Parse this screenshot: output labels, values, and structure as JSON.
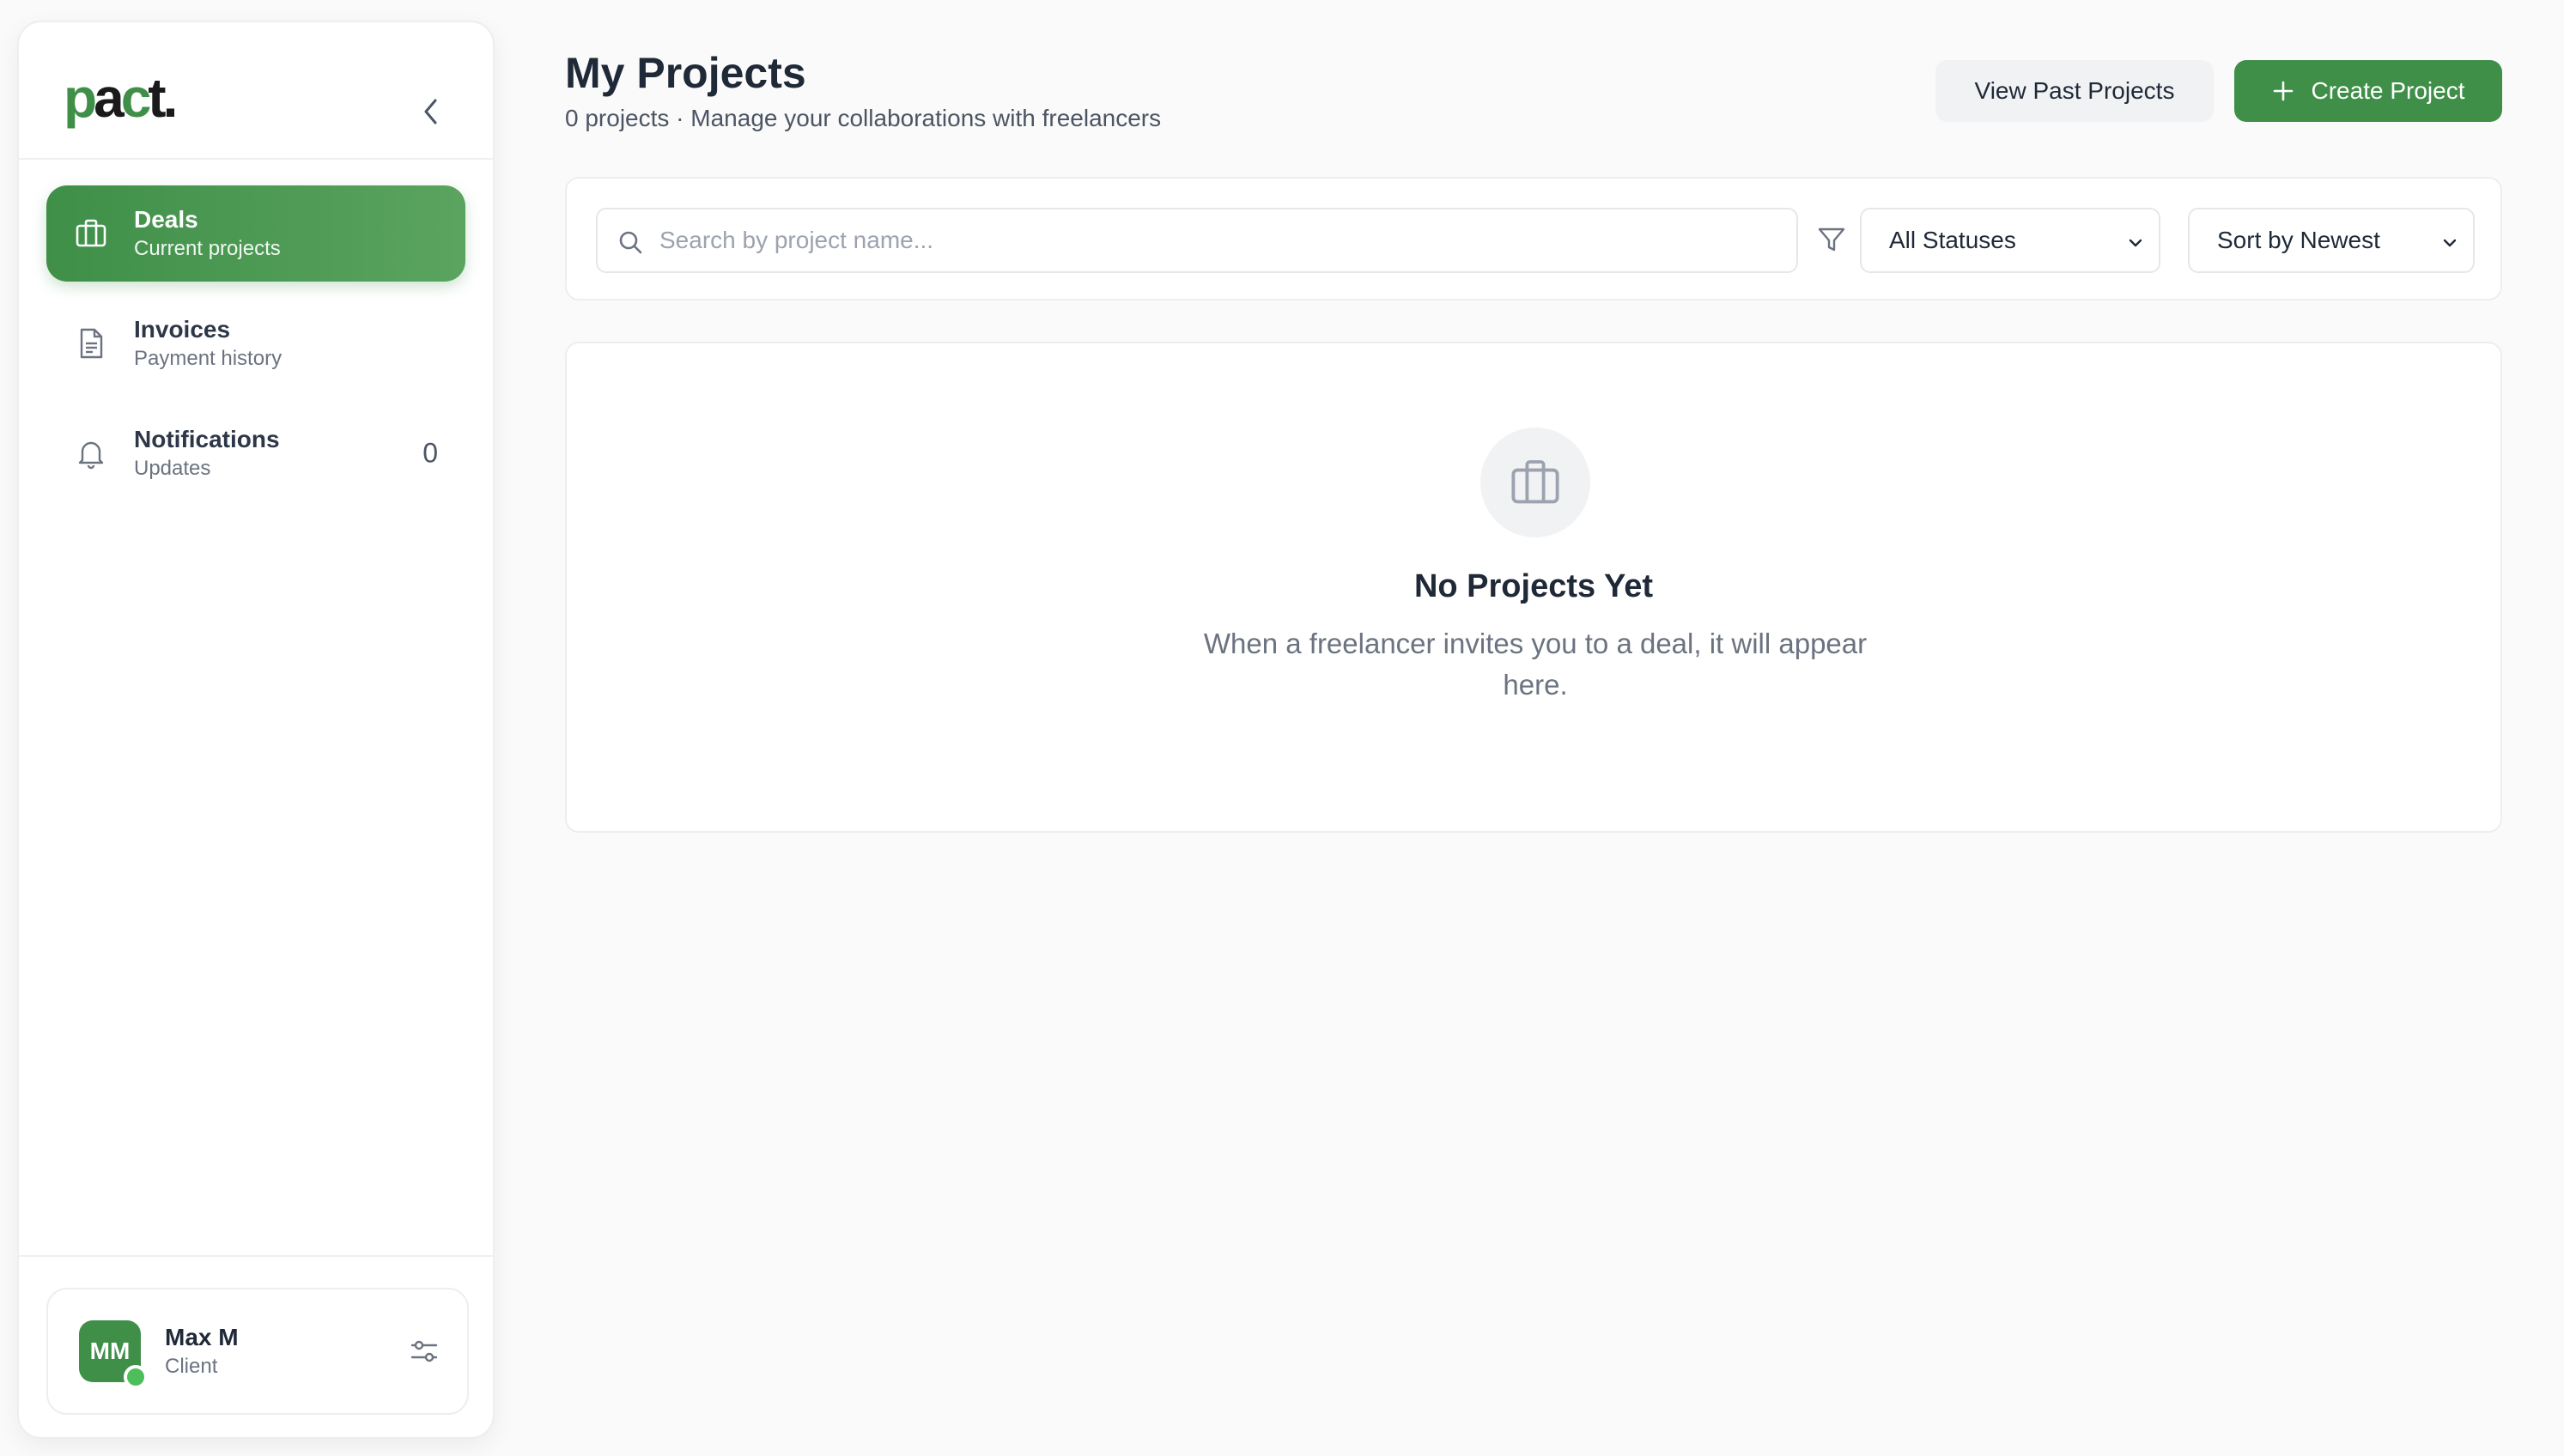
{
  "brand": {
    "logo_text": "pact.",
    "accent": "#3f8f49",
    "online": "#4cbf5a"
  },
  "sidebar": {
    "collapse_icon": "chevron-left-icon",
    "items": [
      {
        "title": "Deals",
        "subtitle": "Current projects",
        "icon": "briefcase-icon",
        "active": true
      },
      {
        "title": "Invoices",
        "subtitle": "Payment history",
        "icon": "document-icon",
        "active": false
      },
      {
        "title": "Notifications",
        "subtitle": "Updates",
        "icon": "bell-icon",
        "count": "0",
        "active": false
      }
    ],
    "user": {
      "initials": "MM",
      "name": "Max M",
      "role": "Client",
      "settings_icon": "sliders-icon"
    }
  },
  "header": {
    "title": "My Projects",
    "subtitle": "0 projects · Manage your collaborations with freelancers",
    "past_button": "View Past Projects",
    "create_button": "Create Project"
  },
  "filters": {
    "search_placeholder": "Search by project name...",
    "status_selected": "All Statuses",
    "sort_selected": "Sort by Newest"
  },
  "empty_state": {
    "title": "No Projects Yet",
    "description": "When a freelancer invites you to a deal, it will appear here."
  }
}
